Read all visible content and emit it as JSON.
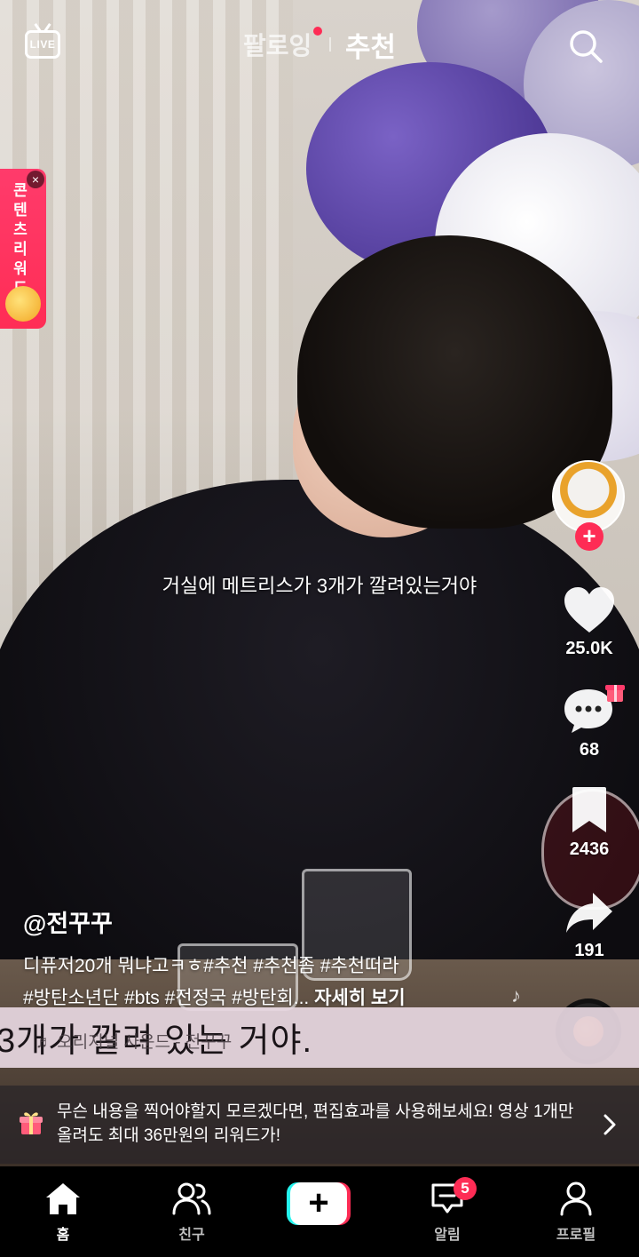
{
  "top_bar": {
    "live_label": "LIVE",
    "tabs": [
      {
        "label": "팔로잉",
        "has_dot": true
      },
      {
        "label": "추천",
        "active": true
      }
    ]
  },
  "reward_banner": {
    "text": "콘텐츠리워드",
    "close": "×"
  },
  "video": {
    "subtitle": "거실에 메트리스가 3개가 깔려있는거야",
    "burned_caption": "3개가 깔려 있는 거야."
  },
  "creator": {
    "follow_symbol": "+"
  },
  "actions": {
    "likes": "25.0K",
    "comments": "68",
    "saves": "2436",
    "shares": "191"
  },
  "post": {
    "username": "@전꾸꾸",
    "caption_line1": "디퓨저20개 뭐냐고ㅋㅎ#추천 #추천좀 #추천떠라",
    "caption_line2": "#방탄소년단 #bts #전정국 #방탄회...",
    "more_label": "자세히 보기",
    "sound": "♬ 오리지널 사운드 - 전꾸꾸"
  },
  "promo": {
    "text": "무슨 내용을 찍어야할지 모르겠다면, 편집효과를 사용해보세요! 영상 1개만 올려도 최대 36만원의 리워드가!"
  },
  "bottom_nav": {
    "home": "홈",
    "friends": "친구",
    "create": "+",
    "inbox": "알림",
    "inbox_badge": "5",
    "profile": "프로필"
  },
  "colors": {
    "accent": "#fe2c55",
    "cyan": "#25f4ee",
    "nav_bg": "#000000"
  }
}
